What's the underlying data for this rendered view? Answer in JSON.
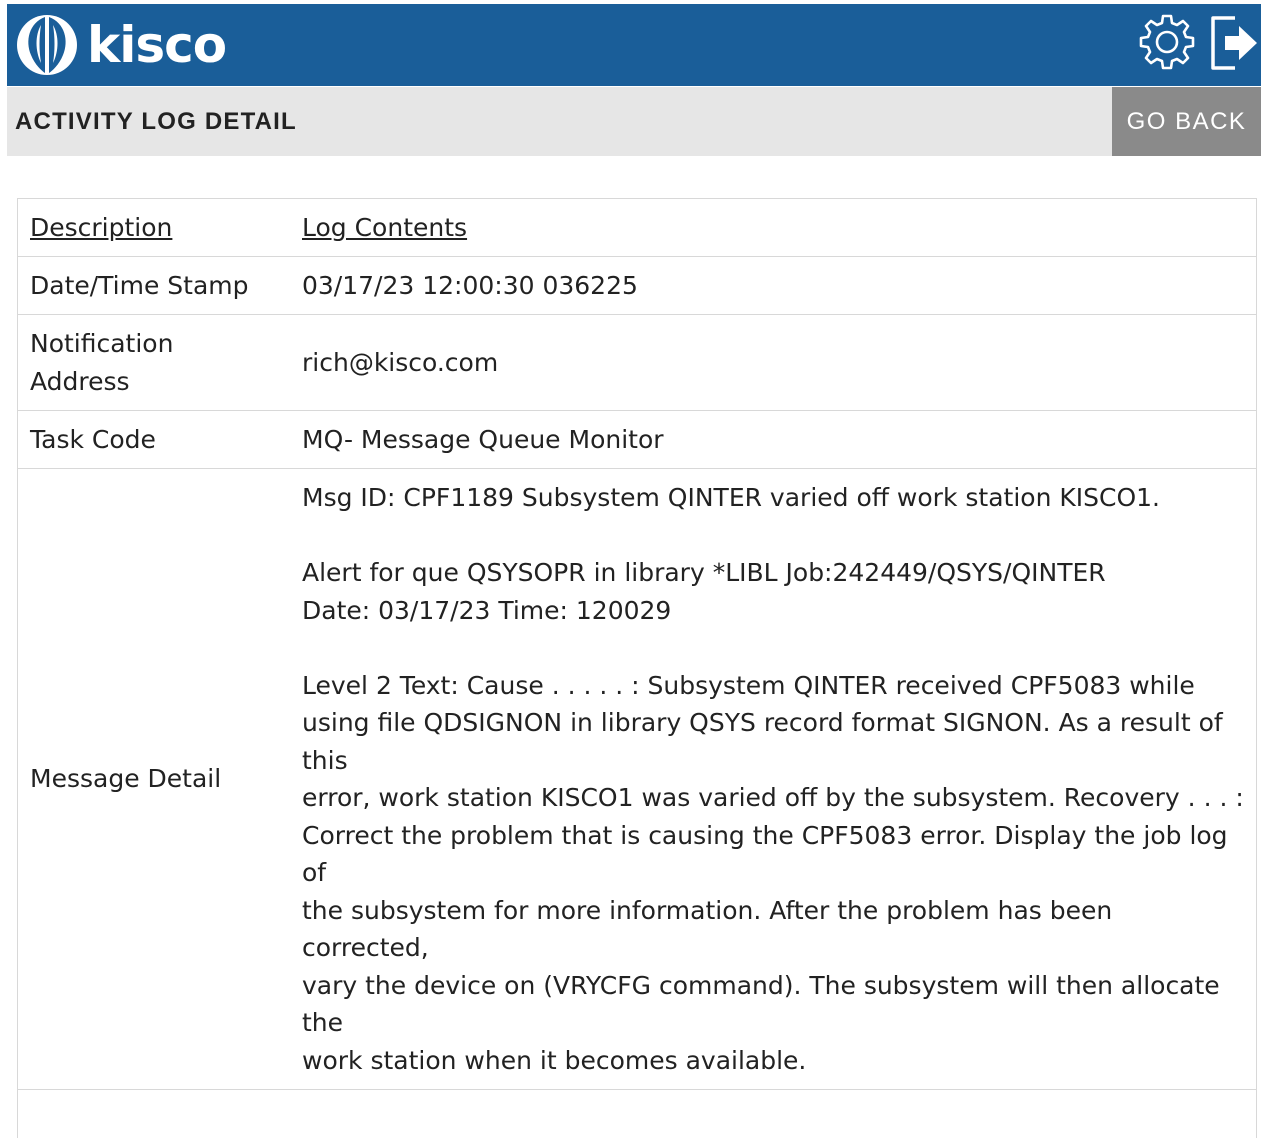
{
  "header": {
    "brand": "kisco",
    "settings_icon": "gear-icon",
    "logout_icon": "logout-icon",
    "color": "#1a5e99"
  },
  "subheader": {
    "title": "ACTIVITY LOG DETAIL",
    "go_back_label": "GO BACK"
  },
  "table": {
    "headers": {
      "description": "Description",
      "contents": "Log Contents"
    },
    "rows": [
      {
        "label": "Date/Time Stamp",
        "value": "03/17/23  12:00:30 036225"
      },
      {
        "label": "Notification Address",
        "value": "rich@kisco.com"
      },
      {
        "label": "Task Code",
        "value": "MQ- Message Queue Monitor"
      }
    ],
    "message": {
      "label": "Message Detail",
      "para1": "Msg ID: CPF1189 Subsystem QINTER varied off work station KISCO1.",
      "para2_line1": "Alert for que QSYSOPR in library *LIBL Job:242449/QSYS/QINTER",
      "para2_line2": "Date: 03/17/23 Time: 120029",
      "para3_line1": "Level 2 Text: Cause . . . . . : Subsystem QINTER received CPF5083 while using file QDSIGNON in library QSYS record format SIGNON. As a result of this",
      "para3_line2": "error, work station KISCO1 was varied off by the subsystem. Recovery . . . :",
      "para3_line3": "Correct the problem that is causing the CPF5083 error. Display the job log of",
      "para3_line4": "the subsystem for more information. After the problem has been corrected,",
      "para3_line5": "vary the device on (VRYCFG command). The subsystem will then allocate the",
      "para3_line6": "work station when it becomes available."
    }
  }
}
